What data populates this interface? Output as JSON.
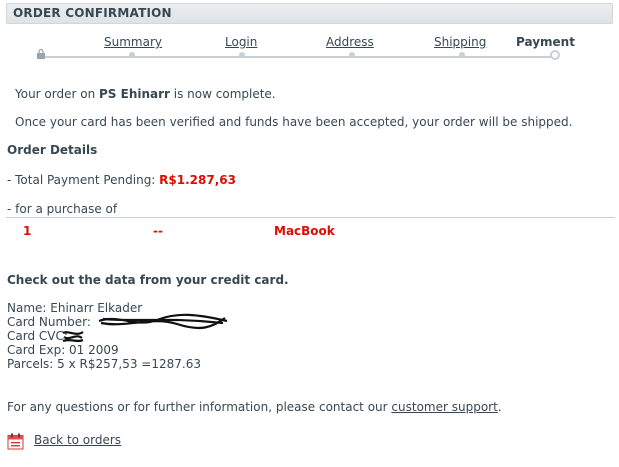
{
  "header": {
    "title": "ORDER CONFIRMATION"
  },
  "steps": [
    {
      "label": "Summary"
    },
    {
      "label": "Login"
    },
    {
      "label": "Address"
    },
    {
      "label": "Shipping"
    },
    {
      "label": "Payment"
    }
  ],
  "message": {
    "line1_prefix": "Your order on ",
    "shop_name": "PS Ehinarr",
    "line1_suffix": " is now complete.",
    "line2": "Once your card has been verified and funds have been accepted, your order will be shipped."
  },
  "order_details": {
    "heading": "Order Details",
    "total_label": "- Total Payment Pending: ",
    "total_value": "R$1.287,63",
    "purchase_label": "- for a purchase of",
    "item": {
      "quantity": "1",
      "reference": "--",
      "name": "MacBook"
    }
  },
  "card": {
    "heading": "Check out the data from your credit card.",
    "name": "Name: Ehinarr Elkader",
    "number_label": "Card Number: ",
    "cvc_label": "Card CVC: ",
    "exp": "Card Exp: 01 2009",
    "parcels": "Parcels: 5 x R$257,53 =1287.63"
  },
  "footer": {
    "contact_prefix": "For any questions or for further information, please contact our ",
    "contact_link": "customer support",
    "contact_suffix": ".",
    "back_link": "Back to orders"
  },
  "colors": {
    "accent_red": "#da0f00",
    "text": "#374853",
    "track": "#c9d0d5"
  }
}
